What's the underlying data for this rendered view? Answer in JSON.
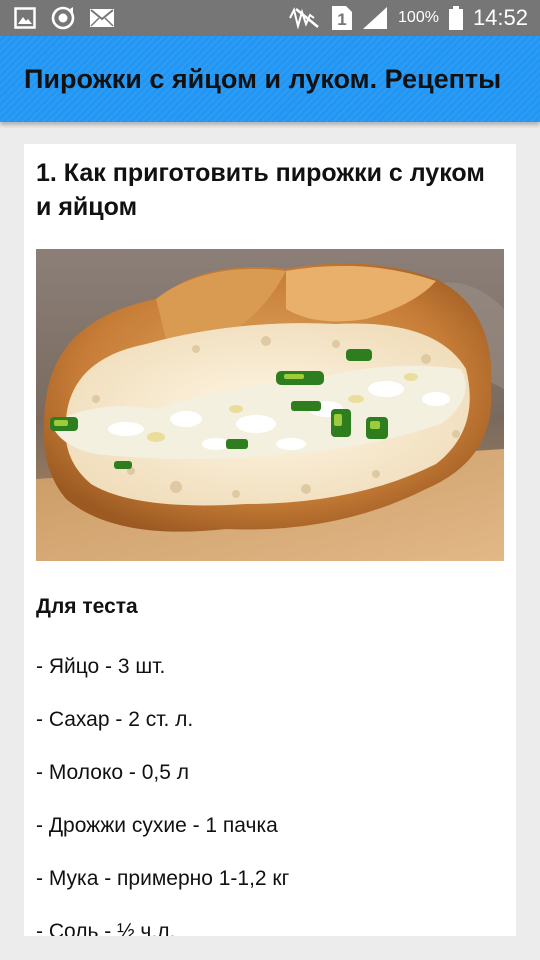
{
  "status_bar": {
    "battery_percent": "100%",
    "time": "14:52",
    "sim_slot": "1",
    "icons": [
      "gallery-icon",
      "sync-icon",
      "mail-icon",
      "mute-icon",
      "sim-icon",
      "signal-icon",
      "battery-icon"
    ]
  },
  "app_bar": {
    "title": "Пирожки с яйцом и луком. Рецепты"
  },
  "recipe": {
    "title": "1. Как приготовить пирожки с луком и яйцом",
    "section_heading": "Для теста",
    "ingredients": [
      "- Яйцо - 3 шт.",
      "- Сахар - 2 ст. л.",
      "- Молоко - 0,5 л",
      "- Дрожжи сухие - 1 пачка",
      "- Мука - примерно 1-1,2 кг",
      "- Соль - ½ ч.л."
    ]
  },
  "colors": {
    "app_bar": "#2196f3",
    "status_bar": "#767676",
    "background": "#ececec",
    "card": "#ffffff"
  }
}
